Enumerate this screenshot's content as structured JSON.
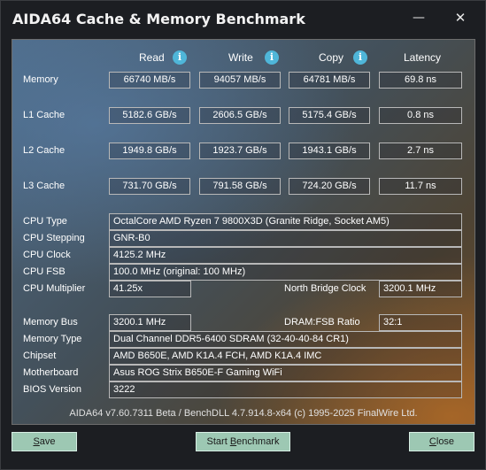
{
  "window": {
    "title": "AIDA64 Cache & Memory Benchmark"
  },
  "titlebar": {
    "minimize_glyph": "—",
    "close_glyph": "✕"
  },
  "columns": {
    "read": "Read",
    "write": "Write",
    "copy": "Copy",
    "latency": "Latency"
  },
  "info_glyph": "i",
  "rows": [
    {
      "label": "Memory",
      "read": "66740 MB/s",
      "write": "94057 MB/s",
      "copy": "64781 MB/s",
      "latency": "69.8 ns"
    },
    {
      "label": "L1 Cache",
      "read": "5182.6 GB/s",
      "write": "2606.5 GB/s",
      "copy": "5175.4 GB/s",
      "latency": "0.8 ns"
    },
    {
      "label": "L2 Cache",
      "read": "1949.8 GB/s",
      "write": "1923.7 GB/s",
      "copy": "1943.1 GB/s",
      "latency": "2.7 ns"
    },
    {
      "label": "L3 Cache",
      "read": "731.70 GB/s",
      "write": "791.58 GB/s",
      "copy": "724.20 GB/s",
      "latency": "11.7 ns"
    }
  ],
  "cpu": {
    "type_label": "CPU Type",
    "type_value": "OctalCore AMD Ryzen 7 9800X3D  (Granite Ridge, Socket AM5)",
    "stepping_label": "CPU Stepping",
    "stepping_value": "GNR-B0",
    "clock_label": "CPU Clock",
    "clock_value": "4125.2 MHz",
    "fsb_label": "CPU FSB",
    "fsb_value": "100.0 MHz  (original: 100 MHz)",
    "multiplier_label": "CPU Multiplier",
    "multiplier_value": "41.25x",
    "nb_label": "North Bridge Clock",
    "nb_value": "3200.1 MHz"
  },
  "system": {
    "membus_label": "Memory Bus",
    "membus_value": "3200.1 MHz",
    "ratio_label": "DRAM:FSB Ratio",
    "ratio_value": "32:1",
    "memtype_label": "Memory Type",
    "memtype_value": "Dual Channel DDR5-6400 SDRAM  (32-40-40-84 CR1)",
    "chipset_label": "Chipset",
    "chipset_value": "AMD B650E, AMD K1A.4 FCH, AMD K1A.4 IMC",
    "mobo_label": "Motherboard",
    "mobo_value": "Asus ROG Strix B650E-F Gaming WiFi",
    "bios_label": "BIOS Version",
    "bios_value": "3222"
  },
  "footer": "AIDA64 v7.60.7311 Beta / BenchDLL 4.7.914.8-x64  (c) 1995-2025 FinalWire Ltd.",
  "buttons": {
    "save_accel": "S",
    "save_rest": "ave",
    "start_pre": "Start ",
    "start_accel": "B",
    "start_rest": "enchmark",
    "close_accel": "C",
    "close_rest": "lose"
  },
  "colors": {
    "accent_info": "#4fb6d9",
    "button_bg": "#9dc8b3"
  },
  "icons": {
    "info": "info-icon",
    "minimize": "minimize-icon",
    "close": "close-icon"
  }
}
